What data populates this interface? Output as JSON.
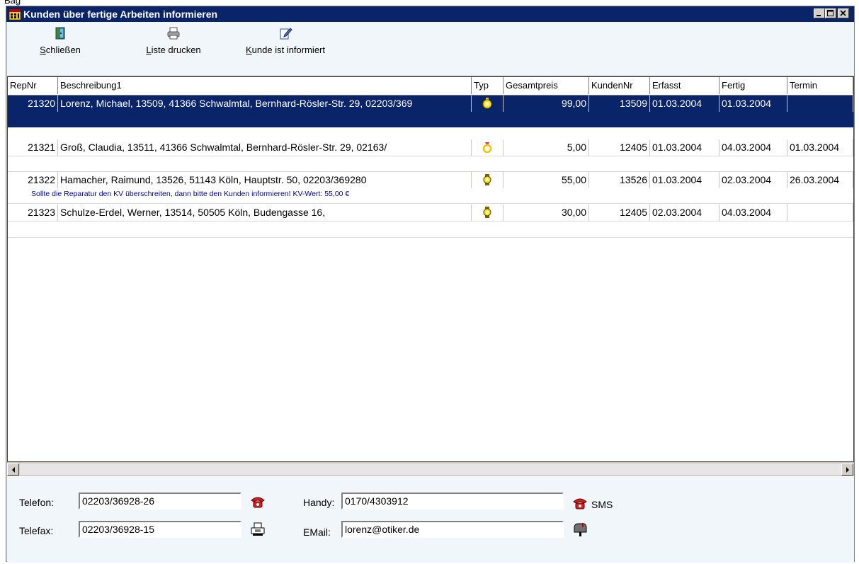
{
  "partial_caption": "Bag",
  "window": {
    "title": "Kunden über fertige Arbeiten informieren",
    "controls": [
      "minimize-icon",
      "maximize-icon",
      "close-icon"
    ]
  },
  "toolbar": {
    "close": {
      "accel": "S",
      "rest": "chließen",
      "icon": "exit-door-icon"
    },
    "print": {
      "accel": "L",
      "rest": "iste drucken",
      "icon": "printer-icon"
    },
    "informed": {
      "accel": "K",
      "rest": "unde ist informiert",
      "icon": "notebook-pen-icon"
    }
  },
  "table": {
    "columns": [
      "RepNr",
      "Beschreibung1",
      "Typ",
      "Gesamtpreis",
      "KundenNr",
      "Erfasst",
      "Fertig",
      "Termin"
    ],
    "rows": [
      {
        "repnr": "21320",
        "beschreibung": "Lorenz, Michael, 13509, 41366 Schwalmtal, Bernhard-Rösler-Str. 29, 02203/369",
        "typ": "pocket-watch-icon",
        "gesamtpreis": "99,00",
        "kundennr": "13509",
        "erfasst": "01.03.2004",
        "fertig": "01.03.2004",
        "termin": "",
        "selected": true
      },
      {
        "repnr": "21321",
        "beschreibung": "Groß, Claudia, 13511, 41366 Schwalmtal, Bernhard-Rösler-Str. 29, 02163/",
        "typ": "ring-icon",
        "gesamtpreis": "5,00",
        "kundennr": "12405",
        "erfasst": "01.03.2004",
        "fertig": "04.03.2004",
        "termin": "01.03.2004",
        "selected": false
      },
      {
        "repnr": "21322",
        "beschreibung": "Hamacher, Raimund, 13526, 51143 Köln, Hauptstr. 50, 02203/369280",
        "typ": "wristwatch-icon",
        "gesamtpreis": "55,00",
        "kundennr": "13526",
        "erfasst": "01.03.2004",
        "fertig": "02.03.2004",
        "termin": "26.03.2004",
        "selected": false,
        "note": "Sollte die Reparatur den KV überschreiten, dann bitte den Kunden informieren! KV-Wert: 55,00 €"
      },
      {
        "repnr": "21323",
        "beschreibung": "Schulze-Erdel, Werner, 13514, 50505 Köln, Budengasse 16,",
        "typ": "wristwatch-icon",
        "gesamtpreis": "30,00",
        "kundennr": "12405",
        "erfasst": "02.03.2004",
        "fertig": "04.03.2004",
        "termin": "",
        "selected": false
      }
    ]
  },
  "contact": {
    "telefon_label": "Telefon:",
    "telefon_value": "02203/36928-26",
    "telefax_label": "Telefax:",
    "telefax_value": "02203/36928-15",
    "handy_label": "Handy:",
    "handy_value": "0170/4303912",
    "sms_label": "SMS",
    "email_label": "EMail:",
    "email_value": "lorenz@otiker.de"
  },
  "colors": {
    "titlebar": "#0a246a",
    "selection": "#0a246a",
    "note_text": "#0000a0",
    "panel": "#f0f6fa"
  }
}
